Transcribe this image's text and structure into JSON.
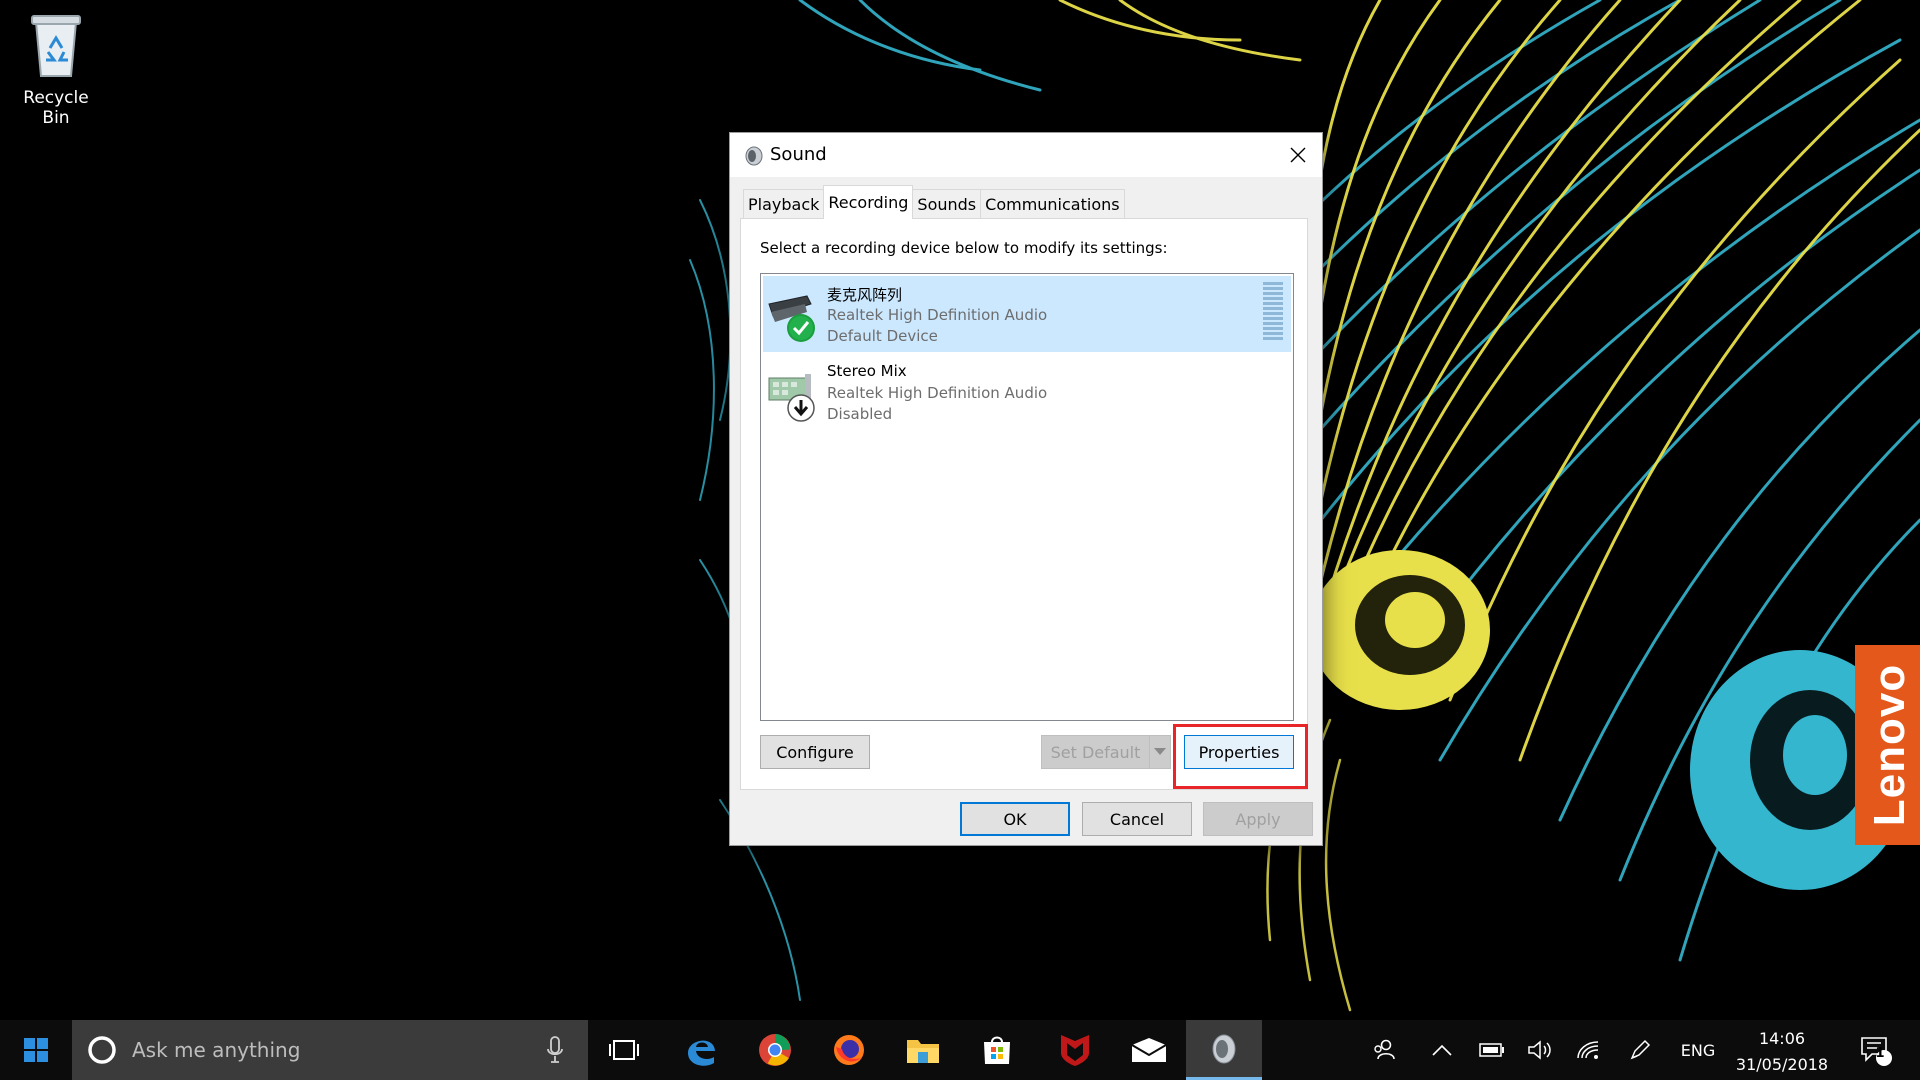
{
  "desktop": {
    "recycle_bin_label": "Recycle Bin",
    "brand": "Lenovo"
  },
  "dialog": {
    "title": "Sound",
    "tabs": [
      {
        "label": "Playback",
        "active": false
      },
      {
        "label": "Recording",
        "active": true
      },
      {
        "label": "Sounds",
        "active": false
      },
      {
        "label": "Communications",
        "active": false
      }
    ],
    "instruction": "Select a recording device below to modify its settings:",
    "devices": [
      {
        "name": "麦克风阵列",
        "driver": "Realtek High Definition Audio",
        "status": "Default Device",
        "selected": true,
        "icon": "microphone-array-icon"
      },
      {
        "name": "Stereo Mix",
        "driver": "Realtek High Definition Audio",
        "status": "Disabled",
        "selected": false,
        "icon": "sound-card-icon"
      }
    ],
    "buttons": {
      "configure": "Configure",
      "set_default": "Set Default",
      "properties": "Properties",
      "ok": "OK",
      "cancel": "Cancel",
      "apply": "Apply"
    }
  },
  "taskbar": {
    "search_placeholder": "Ask me anything",
    "language": "ENG",
    "time": "14:06",
    "date": "31/05/2018",
    "notification_count": "1"
  },
  "colors": {
    "accent": "#0078d7",
    "selection": "#cce8ff",
    "highlight": "#e8262a",
    "lenovo": "#e4581c"
  }
}
